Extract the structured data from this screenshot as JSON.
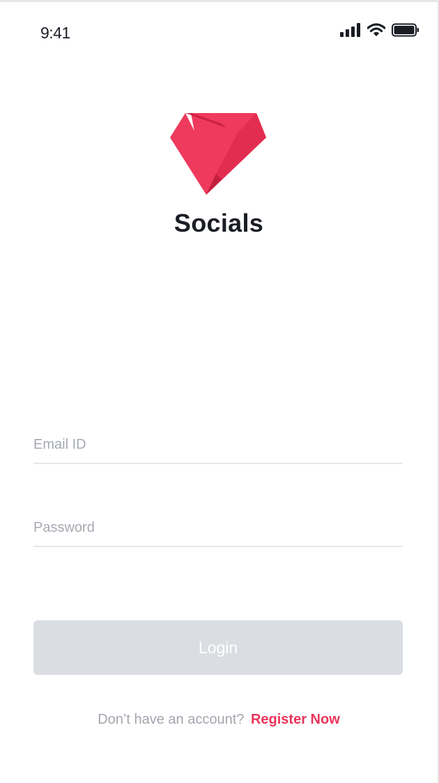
{
  "status_bar": {
    "time": "9:41",
    "icons": [
      "signal-icon",
      "wifi-icon",
      "battery-icon"
    ]
  },
  "brand": {
    "app_name": "Socials",
    "logo_icon": "v-ribbon-logo",
    "accent_color": "#ef3a5d"
  },
  "form": {
    "email": {
      "placeholder": "Email ID",
      "value": ""
    },
    "password": {
      "placeholder": "Password",
      "value": ""
    },
    "login_label": "Login",
    "login_button_color": "#dadde1"
  },
  "footer": {
    "prompt": "Don’t have an account?",
    "register_label": "Register Now",
    "register_color": "#e9345a"
  }
}
